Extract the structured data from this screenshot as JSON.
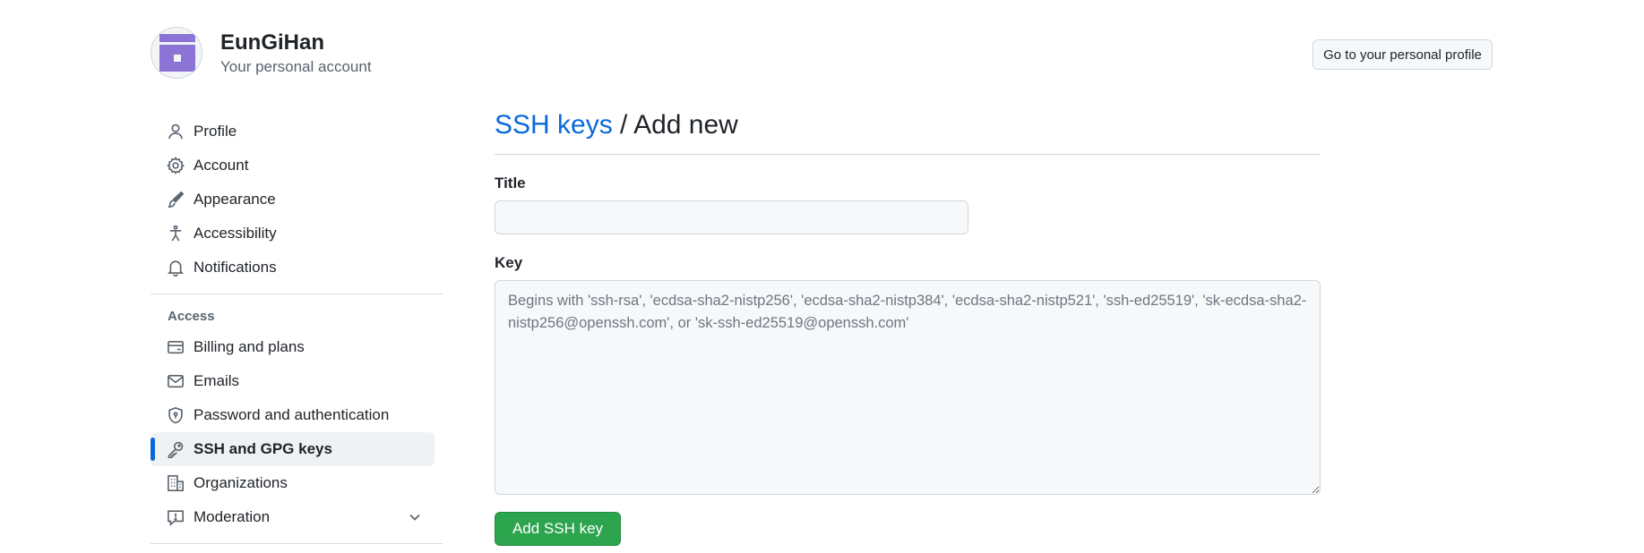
{
  "user": {
    "name": "EunGiHan",
    "subtitle": "Your personal account",
    "profile_button": "Go to your personal profile"
  },
  "sidebar": {
    "items": [
      {
        "label": "Profile",
        "icon": "person-icon"
      },
      {
        "label": "Account",
        "icon": "gear-icon"
      },
      {
        "label": "Appearance",
        "icon": "paintbrush-icon"
      },
      {
        "label": "Accessibility",
        "icon": "accessibility-icon"
      },
      {
        "label": "Notifications",
        "icon": "bell-icon"
      }
    ],
    "access_heading": "Access",
    "access_items": [
      {
        "label": "Billing and plans",
        "icon": "credit-card-icon"
      },
      {
        "label": "Emails",
        "icon": "mail-icon"
      },
      {
        "label": "Password and authentication",
        "icon": "shield-lock-icon"
      },
      {
        "label": "SSH and GPG keys",
        "icon": "key-icon",
        "active": true
      },
      {
        "label": "Organizations",
        "icon": "organization-icon"
      },
      {
        "label": "Moderation",
        "icon": "report-icon"
      }
    ]
  },
  "main": {
    "breadcrumb_link": "SSH keys",
    "breadcrumb_sep": " / ",
    "breadcrumb_current": "Add new",
    "title_label": "Title",
    "title_value": "",
    "key_label": "Key",
    "key_placeholder": "Begins with 'ssh-rsa', 'ecdsa-sha2-nistp256', 'ecdsa-sha2-nistp384', 'ecdsa-sha2-nistp521', 'ssh-ed25519', 'sk-ecdsa-sha2-nistp256@openssh.com', or 'sk-ssh-ed25519@openssh.com'",
    "submit_label": "Add SSH key"
  },
  "colors": {
    "accent": "#0969da",
    "primary_button": "#2da44e",
    "avatar": "#8c73d6"
  }
}
